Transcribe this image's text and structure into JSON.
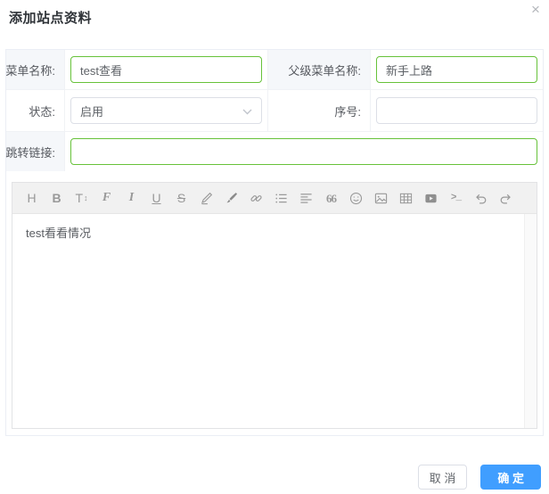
{
  "dialog": {
    "title": "添加站点资料",
    "close_glyph": "×"
  },
  "form": {
    "fields": {
      "menu_name": {
        "label": "菜单名称:",
        "value": "test查看"
      },
      "parent_menu": {
        "label": "父级菜单名称:",
        "value": "新手上路"
      },
      "status": {
        "label": "状态:",
        "value": "启用"
      },
      "sort_order": {
        "label": "序号:",
        "value": ""
      },
      "jump_link": {
        "label": "跳转链接:",
        "value": ""
      }
    }
  },
  "editor": {
    "content": "test看看情况",
    "toolbar": [
      {
        "name": "heading",
        "glyph": "H"
      },
      {
        "name": "bold",
        "glyph": "B"
      },
      {
        "name": "font-size",
        "glyph": "T",
        "glyph2": "↕"
      },
      {
        "name": "font-family",
        "glyph": "F"
      },
      {
        "name": "italic",
        "glyph": "I"
      },
      {
        "name": "underline",
        "glyph": "U"
      },
      {
        "name": "strikethrough",
        "glyph": "S"
      },
      {
        "name": "highlight-pen"
      },
      {
        "name": "text-color-brush"
      },
      {
        "name": "link"
      },
      {
        "name": "unordered-list"
      },
      {
        "name": "justify"
      },
      {
        "name": "quote",
        "glyph": "66"
      },
      {
        "name": "emoticon"
      },
      {
        "name": "image"
      },
      {
        "name": "table"
      },
      {
        "name": "video"
      },
      {
        "name": "code",
        "glyph": ">_"
      },
      {
        "name": "undo"
      },
      {
        "name": "redo"
      }
    ]
  },
  "footer": {
    "cancel_label": "取 消",
    "confirm_label": "确 定"
  },
  "colors": {
    "accent_green": "#67c23a",
    "primary_blue": "#409eff",
    "label_bg": "#f5f7fa",
    "toolbar_bg": "#f1f1f1",
    "border_gray": "#dcdfe6"
  }
}
